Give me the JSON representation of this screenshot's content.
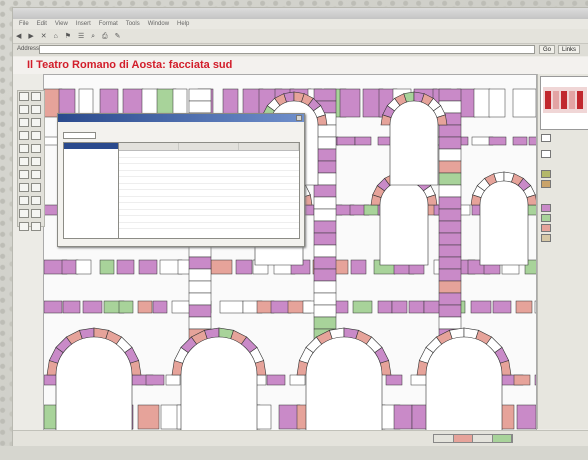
{
  "window": {
    "title": "",
    "menu": [
      "File",
      "Edit",
      "View",
      "Insert",
      "Format",
      "Tools",
      "Window",
      "Help"
    ],
    "toolbar": [
      "◀",
      "▶",
      "✕",
      "⌂",
      "⚑",
      "☰",
      "⌕",
      "⎙",
      "✎"
    ]
  },
  "address": {
    "label": "Address",
    "value": "",
    "go_label": "Go",
    "links_label": "Links"
  },
  "headline": {
    "text": "Il Teatro Romano di Aosta: facciata sud"
  },
  "property_dialog": {
    "title": "",
    "field_value": "",
    "headers": [
      "",
      "",
      ""
    ],
    "rows": [
      [
        "",
        "",
        ""
      ],
      [
        "",
        "",
        ""
      ],
      [
        "",
        "",
        ""
      ],
      [
        "",
        "",
        ""
      ],
      [
        "",
        "",
        ""
      ],
      [
        "",
        "",
        ""
      ],
      [
        "",
        "",
        ""
      ],
      [
        "",
        "",
        ""
      ],
      [
        "",
        "",
        ""
      ],
      [
        "",
        "",
        ""
      ],
      [
        "",
        "",
        ""
      ],
      [
        "",
        "",
        ""
      ]
    ]
  },
  "right_panel": {
    "items": [
      "",
      "",
      "",
      "",
      "",
      "",
      "",
      ""
    ]
  },
  "colors": {
    "accent": "#d21d2a",
    "pink_block": "#c98ac8",
    "green_block": "#a8d39a",
    "salmon_block": "#e6a39a"
  },
  "footer": {
    "text": ""
  }
}
